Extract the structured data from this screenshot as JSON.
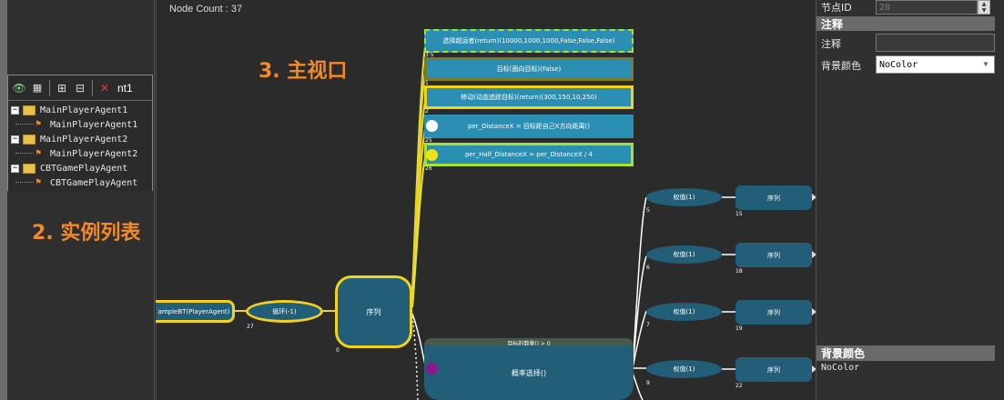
{
  "instance_list": {
    "toolbar_text": "nt1",
    "items": [
      {
        "label": "MainPlayerAgent1",
        "type": "folder"
      },
      {
        "label": "MainPlayerAgent1",
        "type": "agent"
      },
      {
        "label": "MainPlayerAgent2",
        "type": "folder"
      },
      {
        "label": "MainPlayerAgent2",
        "type": "agent"
      },
      {
        "label": "CBTGamePlayAgent",
        "type": "folder"
      },
      {
        "label": "CBTGamePlayAgent",
        "type": "agent"
      }
    ],
    "section_label": "2. 实例列表"
  },
  "viewport": {
    "node_count": "Node Count : 37",
    "section_label": "3. 主视口",
    "nodes": {
      "root": "ampleBT(PlayerAgent)",
      "loop": "循环(-1)",
      "loop_idx": "27",
      "seq_main": "序列",
      "seq_main_idx": "0",
      "select_target": "选择超运者(return)(10000,1000,1000,False,False,False)",
      "select_target_idx": "3·5",
      "target": "目标(面向目标)(False)",
      "target_idx": "1",
      "move": "移动(动态追踪目标)(return)(300,150,10,250)",
      "move_idx": "2",
      "per_distance": "per_DistanceX  =  目标距自己X方向距离()",
      "per_distance_idx": "25",
      "per_half": "per_Half_DistanceX  = per_DistanceX  /  4",
      "per_half_idx": "26",
      "rand_header": "目标的数量() > 0",
      "rand_select": "概率选择()",
      "weights": [
        {
          "label": "权值(1)",
          "idx": "5",
          "seq": "序列",
          "seq_idx": "15"
        },
        {
          "label": "权值(1)",
          "idx": "6",
          "seq": "序列",
          "seq_idx": "18"
        },
        {
          "label": "权值(1)",
          "idx": "7",
          "seq": "序列",
          "seq_idx": "19"
        },
        {
          "label": "权值(1)",
          "idx": "9",
          "seq": "序列",
          "seq_idx": "22"
        }
      ]
    }
  },
  "properties": {
    "node_id_label": "节点ID",
    "node_id_value": "28",
    "comment_header": "注释",
    "comment_label": "注释",
    "comment_value": "",
    "bg_color_label": "背景颜色",
    "bg_color_value": "NoColor",
    "desc_header": "背景颜色",
    "desc_value": "NoColor"
  },
  "colors": {
    "accent_orange": "#f08a2a",
    "node_blue": "#2b8fb3",
    "node_dark": "#225e78",
    "yellow_border": "#f2d21b",
    "green_border": "#a6e22e"
  }
}
